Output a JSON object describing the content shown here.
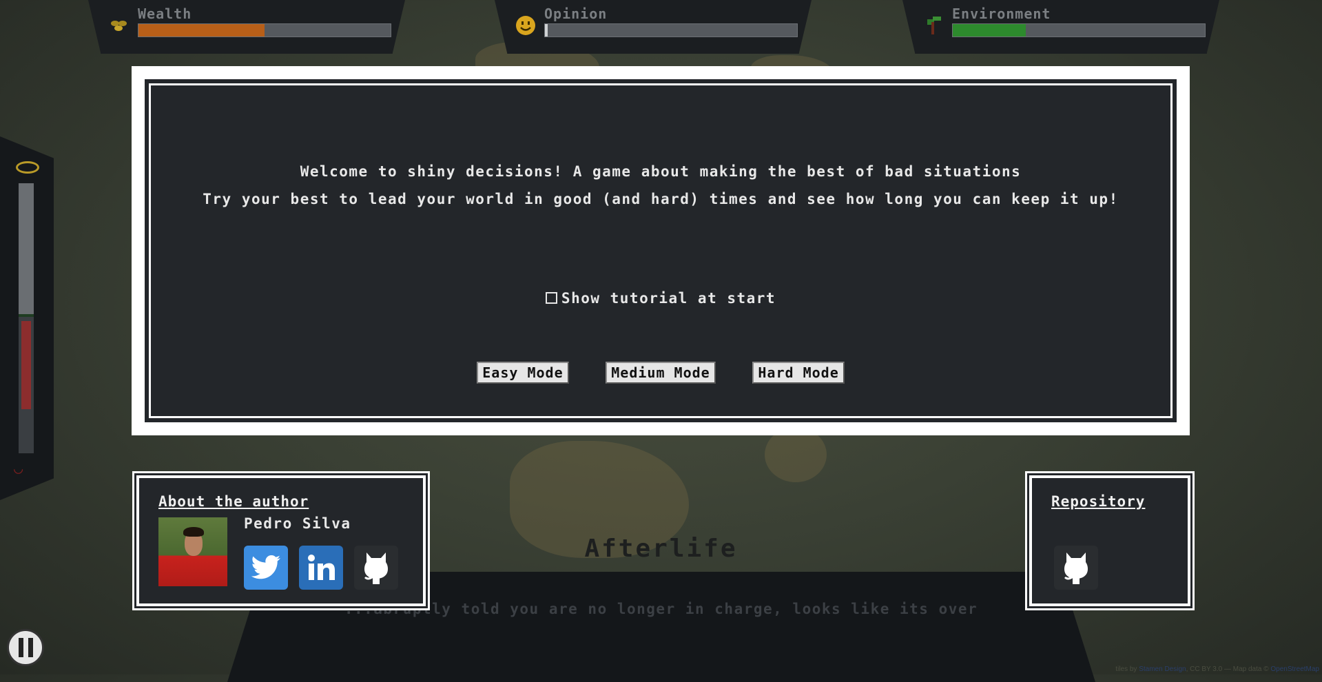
{
  "stats": {
    "wealth": {
      "label": "Wealth",
      "icon": "coins-icon",
      "level": 0.5,
      "color": "#b85f18"
    },
    "opinion": {
      "label": "Opinion",
      "icon": "smiley-icon",
      "level": 0.01,
      "color": "#cfd2d4"
    },
    "environment": {
      "label": "Environment",
      "icon": "tree-icon",
      "level": 0.29,
      "color": "#2d8a2d"
    }
  },
  "dialog": {
    "welcome": "Welcome to shiny decisions! A game about making the best of bad situations",
    "tagline": "Try your best to lead your world in good (and hard) times and see how long you can keep it up!",
    "tutorial_label": "Show tutorial at start",
    "tutorial_checked": false,
    "modes": {
      "easy": "Easy Mode",
      "medium": "Medium Mode",
      "hard": "Hard Mode"
    }
  },
  "background": {
    "afterlife_title": "Afterlife",
    "afterlife_text": "...abruptly told you are no longer in charge, looks like its over"
  },
  "about": {
    "title": "About the author",
    "name": "Pedro Silva"
  },
  "repository": {
    "title": "Repository"
  },
  "attribution": {
    "prefix": "tiles by ",
    "stamen": "Stamen Design",
    "middle": ", CC BY 3.0 — Map data © ",
    "osm": "OpenStreetMap"
  }
}
